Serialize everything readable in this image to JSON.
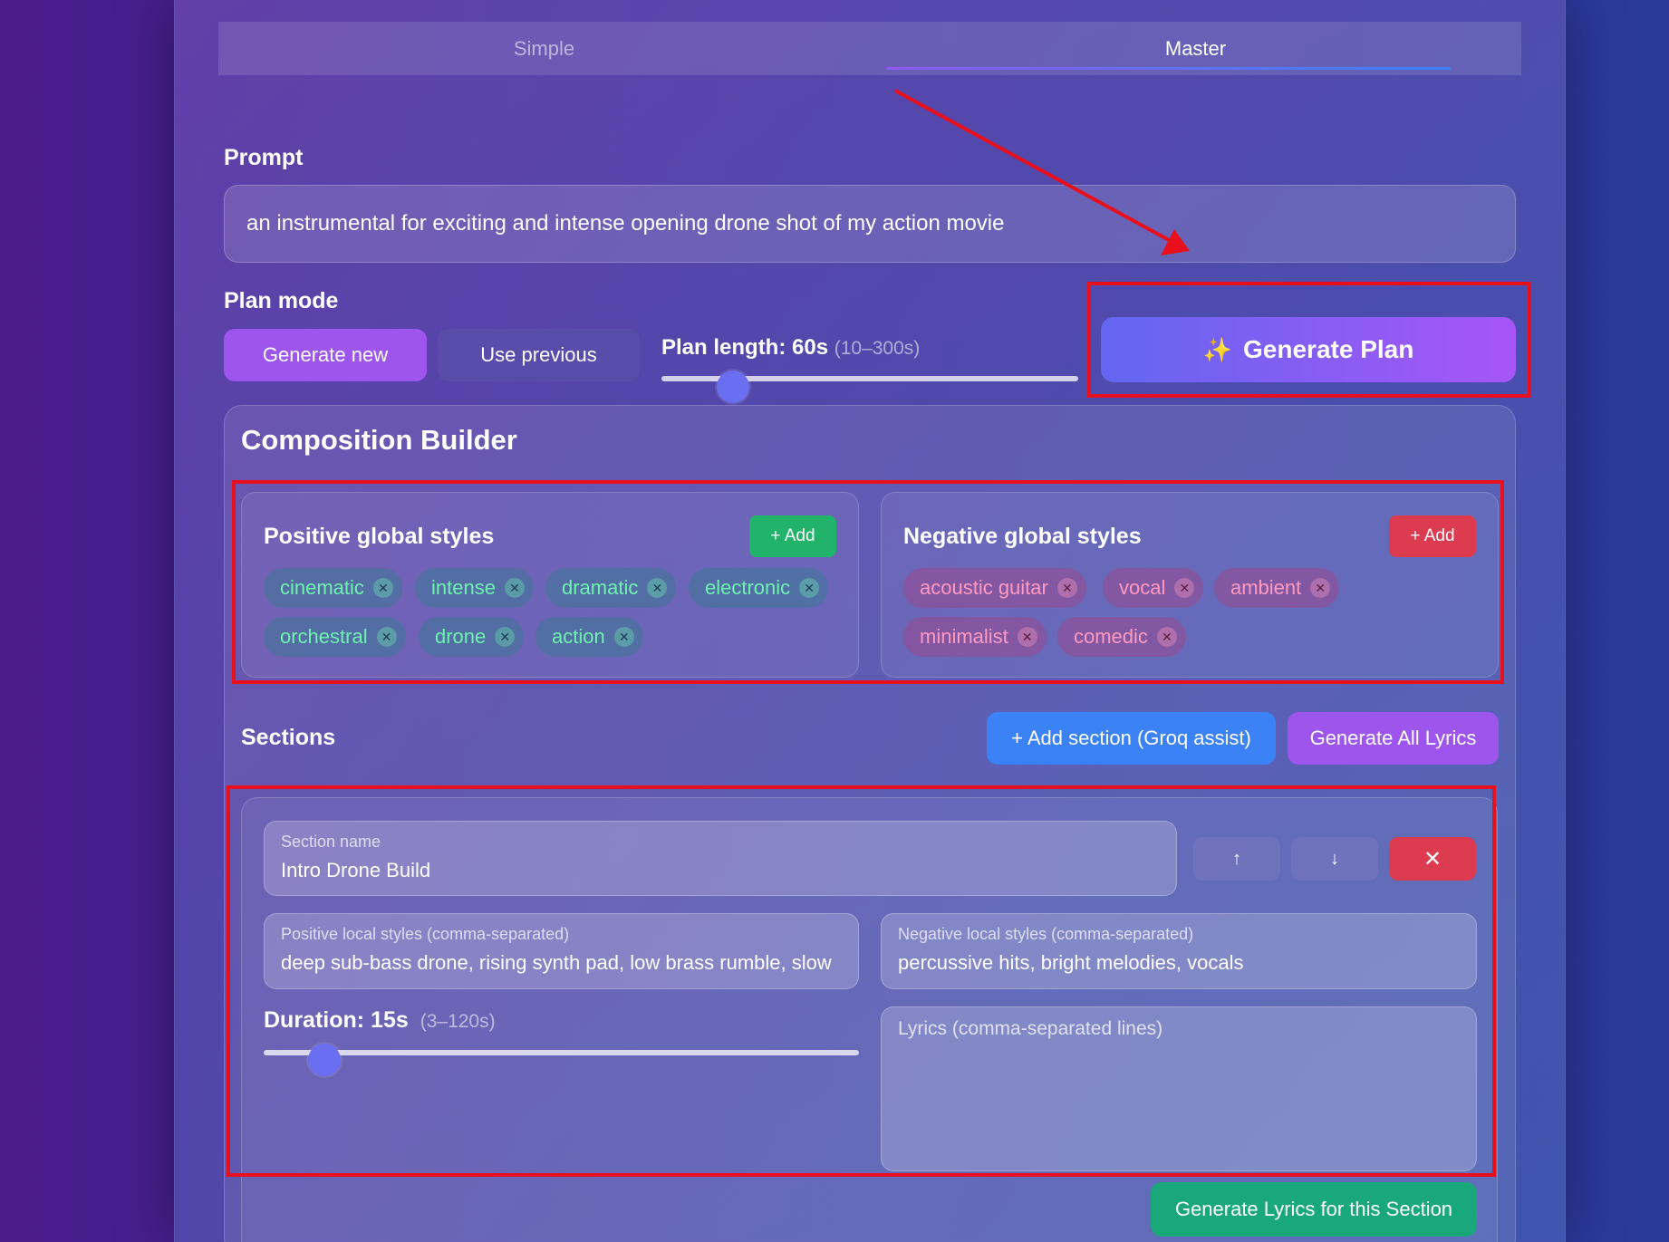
{
  "tabs": [
    {
      "label": "Simple",
      "active": false
    },
    {
      "label": "Master",
      "active": true
    }
  ],
  "prompt": {
    "label": "Prompt",
    "value": "an instrumental for exciting and intense opening drone shot of my action movie"
  },
  "plan_mode": {
    "label": "Plan mode",
    "generate_new_label": "Generate new",
    "use_previous_label": "Use previous",
    "length_label": "Plan length: 60s",
    "length_range": "(10–300s)",
    "length_value": 60,
    "length_min": 10,
    "length_max": 300
  },
  "generate_plan": {
    "icon": "sparkles-icon",
    "glyph": "✨",
    "label": "Generate Plan"
  },
  "composition": {
    "title": "Composition Builder",
    "positive": {
      "title": "Positive global styles",
      "add_label": "+ Add",
      "tags": [
        "cinematic",
        "intense",
        "dramatic",
        "electronic",
        "orchestral",
        "drone",
        "action"
      ]
    },
    "negative": {
      "title": "Negative global styles",
      "add_label": "+ Add",
      "tags": [
        "acoustic guitar",
        "vocal",
        "ambient",
        "minimalist",
        "comedic"
      ]
    },
    "tag_remove_glyph": "✕"
  },
  "sections": {
    "label": "Sections",
    "add_section_label": "+ Add section (Groq assist)",
    "generate_all_label": "Generate All Lyrics",
    "items": [
      {
        "name_label": "Section name",
        "name_value": "Intro Drone Build",
        "up_glyph": "↑",
        "down_glyph": "↓",
        "delete_glyph": "✕",
        "pos_local_label": "Positive local styles (comma-separated)",
        "pos_local_value": "deep sub-bass drone, rising synth pad, low brass rumble, slow",
        "neg_local_label": "Negative local styles (comma-separated)",
        "neg_local_value": "percussive hits, bright melodies, vocals",
        "duration_label": "Duration: 15s",
        "duration_range": "(3–120s)",
        "duration_value": 15,
        "duration_min": 3,
        "duration_max": 120,
        "lyrics_placeholder": "Lyrics (comma-separated lines)",
        "generate_lyrics_label": "Generate Lyrics for this Section"
      }
    ]
  },
  "colors": {
    "accent_purple": "#9d55ee",
    "accent_blue": "#3b82f6",
    "add_positive": "#22b36a",
    "add_negative": "#dc3b50",
    "annotation_red": "#e8101c",
    "generate_lyrics_green": "#18a87a"
  }
}
